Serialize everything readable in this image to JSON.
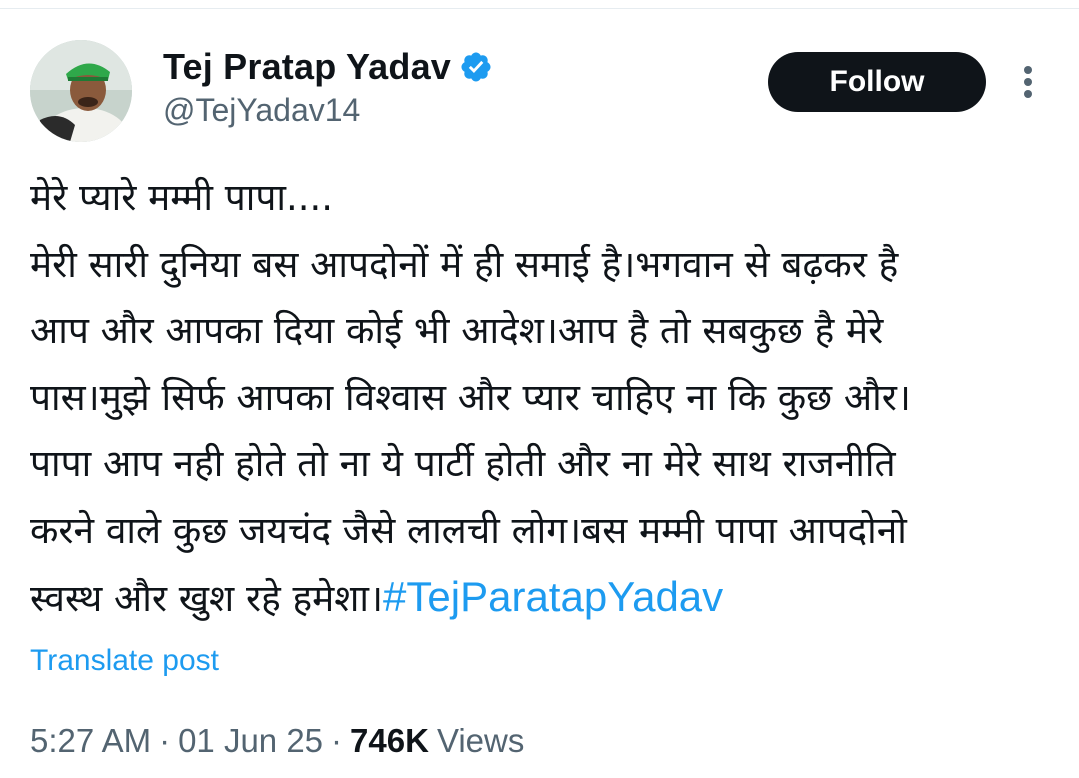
{
  "author": {
    "display_name": "Tej Pratap Yadav",
    "handle": "@TejYadav14",
    "verified": true,
    "verified_color": "#1d9bf0",
    "avatar_icon": "profile-photo-green-cap"
  },
  "actions": {
    "follow_label": "Follow",
    "more_icon": "vertical-ellipsis-icon"
  },
  "tweet": {
    "lines": [
      "मेरे प्यारे मम्मी पापा....",
      "मेरी सारी दुनिया बस आपदोनों में ही समाई है।भगवान से बढ़कर है",
      "आप और आपका दिया कोई भी आदेश।आप है तो सबकुछ है मेरे",
      "पास।मुझे सिर्फ आपका विश्वास और प्यार चाहिए ना कि कुछ और।",
      "पापा आप नही होते तो ना ये पार्टी होती और ना मेरे साथ राजनीति",
      "करने वाले कुछ जयचंद जैसे लालची लोग।बस मम्मी पापा आपदोनो",
      "स्वस्थ और खुश रहे हमेशा।"
    ],
    "hashtag": "#TejParatapYadav",
    "link_color": "#1d9bf0"
  },
  "translate_label": "Translate post",
  "meta": {
    "time": "5:27 AM",
    "separator": "·",
    "date": "01 Jun 25",
    "views_count": "746K",
    "views_label": "Views"
  }
}
